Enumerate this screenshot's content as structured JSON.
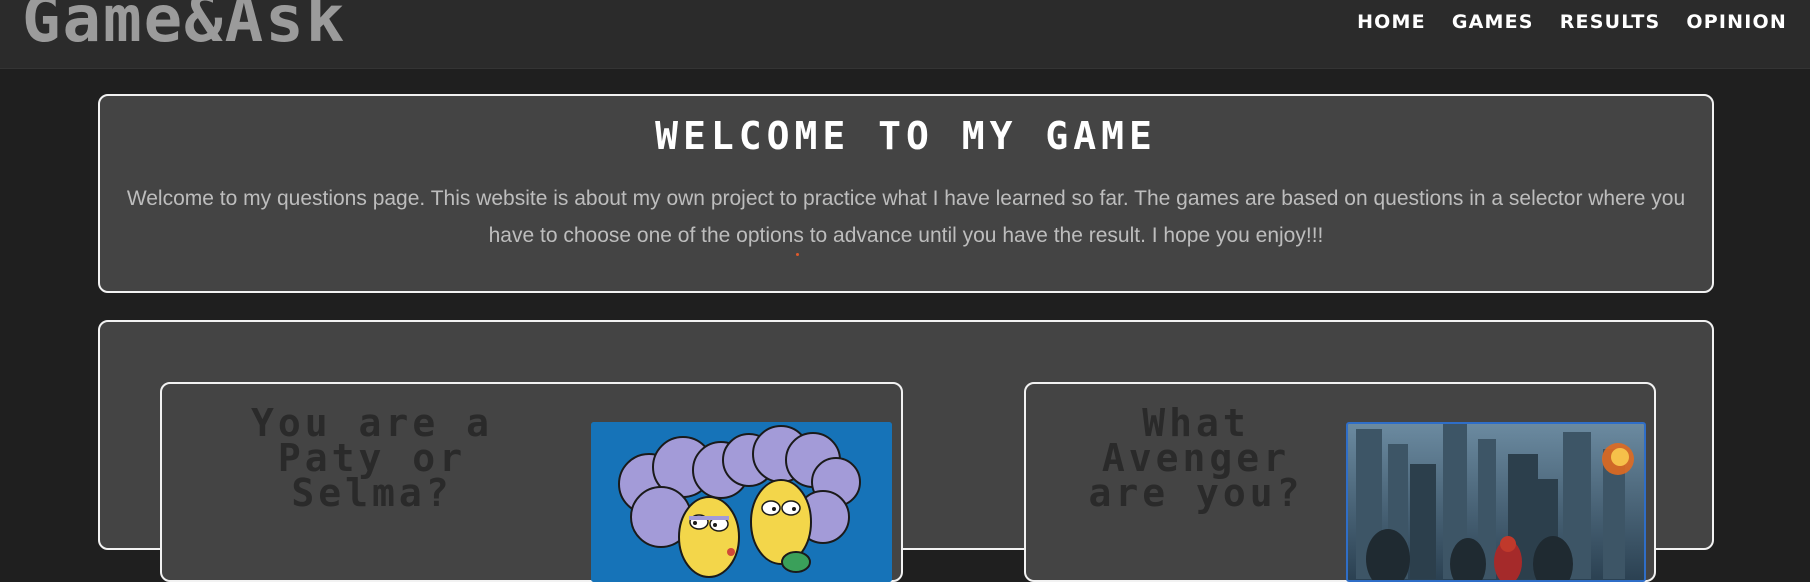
{
  "header": {
    "brand": "Game&Ask",
    "nav": [
      {
        "label": "HOME"
      },
      {
        "label": "GAMES"
      },
      {
        "label": "RESULTS"
      },
      {
        "label": "OPINION"
      }
    ]
  },
  "welcome": {
    "title": "WELCOME TO MY GAME",
    "text": "Welcome to my questions page. This website is about my own project to practice what I have learned so far. The games are based on questions in a selector where you have to choose one of the options to advance until you have the result. I hope you enjoy!!!"
  },
  "games": [
    {
      "title": "You are a Paty or Selma?",
      "image": "simpsons-patty-selma-image"
    },
    {
      "title": "What Avenger are you?",
      "image": "avengers-team-image"
    }
  ],
  "colors": {
    "background": "#1f1f1f",
    "header": "#2b2b2b",
    "panel": "#444444",
    "border": "#f2f2f2",
    "brand_text": "#9b9b9b",
    "body_text": "#bdbdbd",
    "card_title": "#2a2a2a",
    "simpsons_sky": "#1673b8",
    "avengers_frame": "#2f6ec8"
  }
}
